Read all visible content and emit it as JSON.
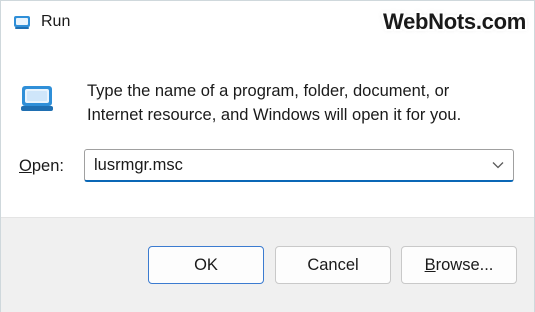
{
  "window": {
    "title": "Run",
    "icon": "run-app-icon"
  },
  "watermark": "WebNots.com",
  "content": {
    "icon": "run-icon",
    "description_line1": "Type the name of a program, folder, document, or",
    "description_line2": "Internet resource, and Windows will open it for you.",
    "open_label_prefix": "O",
    "open_label_rest": "pen:",
    "combo_value": "lusrmgr.msc"
  },
  "buttons": {
    "ok_label": "OK",
    "cancel_label": "Cancel",
    "browse_label_prefix": "B",
    "browse_label_rest": "rowse..."
  },
  "colors": {
    "background": "#1fa6c0",
    "accent": "#0a67b6",
    "icon_blue": "#2f8fd8"
  }
}
